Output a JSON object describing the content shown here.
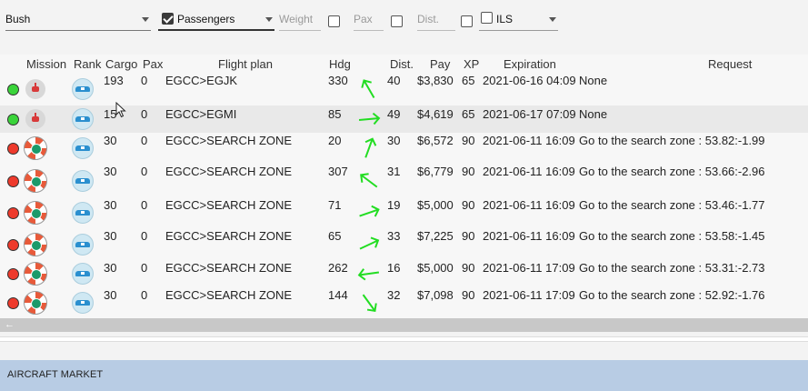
{
  "filters": {
    "aircraft": {
      "value": "Bush"
    },
    "passengers": {
      "label": "Passengers",
      "checked": true
    },
    "weight": {
      "placeholder": "Weight"
    },
    "pax": {
      "placeholder": "Pax"
    },
    "dist": {
      "placeholder": "Dist."
    },
    "ils": {
      "label": "ILS"
    }
  },
  "columns": [
    "Mission",
    "Rank",
    "Cargo",
    "Pax",
    "Flight plan",
    "Hdg",
    "Dist.",
    "Pay",
    "XP",
    "Expiration",
    "Request"
  ],
  "rows": [
    {
      "status": "green",
      "mission_icon": "plane-icon",
      "cargo": "193",
      "pax": "0",
      "plan": "EGCC>EGJK",
      "hdg": "330",
      "dist": "40",
      "pay": "$3,830",
      "xp": "65",
      "exp": "2021-06-16 04:09",
      "request": "None"
    },
    {
      "status": "green",
      "mission_icon": "plane-icon",
      "cargo": "15",
      "pax": "0",
      "plan": "EGCC>EGMI",
      "hdg": "85",
      "dist": "49",
      "pay": "$4,619",
      "xp": "65",
      "exp": "2021-06-17 07:09",
      "request": "None"
    },
    {
      "status": "red",
      "mission_icon": "lifering-icon",
      "cargo": "30",
      "pax": "0",
      "plan": "EGCC>SEARCH ZONE",
      "hdg": "20",
      "dist": "30",
      "pay": "$6,572",
      "xp": "90",
      "exp": "2021-06-11 16:09",
      "request": "Go to the search zone : 53.82:-1.99"
    },
    {
      "status": "red",
      "mission_icon": "lifering-icon",
      "cargo": "30",
      "pax": "0",
      "plan": "EGCC>SEARCH ZONE",
      "hdg": "307",
      "dist": "31",
      "pay": "$6,779",
      "xp": "90",
      "exp": "2021-06-11 16:09",
      "request": "Go to the search zone : 53.66:-2.96"
    },
    {
      "status": "red",
      "mission_icon": "lifering-icon",
      "cargo": "30",
      "pax": "0",
      "plan": "EGCC>SEARCH ZONE",
      "hdg": "71",
      "dist": "19",
      "pay": "$5,000",
      "xp": "90",
      "exp": "2021-06-11 16:09",
      "request": "Go to the search zone : 53.46:-1.77"
    },
    {
      "status": "red",
      "mission_icon": "lifering-icon",
      "cargo": "30",
      "pax": "0",
      "plan": "EGCC>SEARCH ZONE",
      "hdg": "65",
      "dist": "33",
      "pay": "$7,225",
      "xp": "90",
      "exp": "2021-06-11 16:09",
      "request": "Go to the search zone : 53.58:-1.45"
    },
    {
      "status": "red",
      "mission_icon": "lifering-icon",
      "cargo": "30",
      "pax": "0",
      "plan": "EGCC>SEARCH ZONE",
      "hdg": "262",
      "dist": "16",
      "pay": "$5,000",
      "xp": "90",
      "exp": "2021-06-11 17:09",
      "request": "Go to the search zone : 53.31:-2.73"
    },
    {
      "status": "red",
      "mission_icon": "lifering-icon",
      "cargo": "30",
      "pax": "0",
      "plan": "EGCC>SEARCH ZONE",
      "hdg": "144",
      "dist": "32",
      "pay": "$7,098",
      "xp": "90",
      "exp": "2021-06-11 17:09",
      "request": "Go to the search zone : 52.92:-1.76"
    }
  ],
  "market": {
    "label": "AIRCRAFT MARKET"
  },
  "colors": {
    "arrow": "#22dd22",
    "status_green": "#3ad43a",
    "status_red": "#ee3a2c",
    "market_bar": "#b8cce4"
  }
}
